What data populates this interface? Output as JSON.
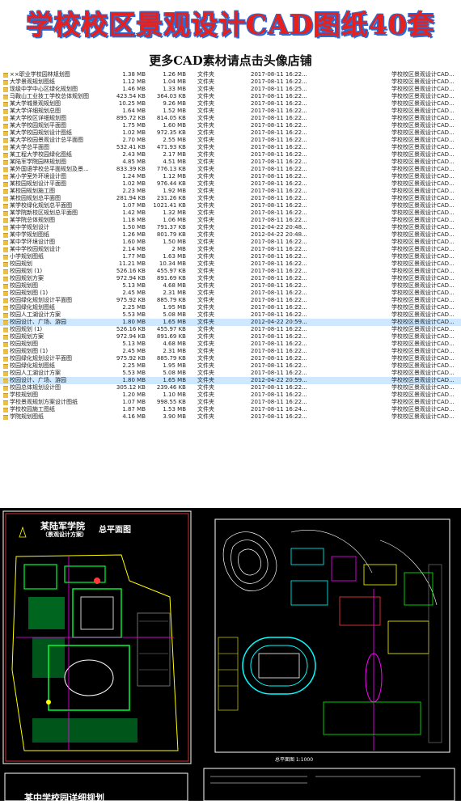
{
  "banner": {
    "title": "学校校区景观设计CAD图纸40套",
    "subtitle": "更多CAD素材请点击头像店铺"
  },
  "files": [
    {
      "name": "××职业学校园林规划图",
      "size1": "1.38 MB",
      "size2": "1.26 MB",
      "type": "文件夹",
      "date": "2017-08-11 16:22...",
      "desc": "学校校区景观设计CAD..."
    },
    {
      "name": "大学景观规划图纸",
      "size1": "1.12 MB",
      "size2": "1.04 MB",
      "type": "文件夹",
      "date": "2017-08-11 16:22...",
      "desc": "学校校区景观设计CAD..."
    },
    {
      "name": "现级中学中心区绿化规划图",
      "size1": "1.46 MB",
      "size2": "1.33 MB",
      "type": "文件夹",
      "date": "2017-08-11 16:25...",
      "desc": "学校校区景观设计CAD..."
    },
    {
      "name": "马鞍山工业技工学校总体规划图",
      "size1": "423.54 KB",
      "size2": "364.03 KB",
      "type": "文件夹",
      "date": "2017-08-11 16:22...",
      "desc": "学校校区景观设计CAD..."
    },
    {
      "name": "某大学城景观规划图",
      "size1": "10.25 MB",
      "size2": "9.26 MB",
      "type": "文件夹",
      "date": "2017-08-11 16:22...",
      "desc": "学校校区景观设计CAD..."
    },
    {
      "name": "某大学详细规划总图",
      "size1": "1.64 MB",
      "size2": "1.52 MB",
      "type": "文件夹",
      "date": "2017-08-11 16:22...",
      "desc": "学校校区景观设计CAD..."
    },
    {
      "name": "某大学校区详细规划图",
      "size1": "895.72 KB",
      "size2": "814.05 KB",
      "type": "文件夹",
      "date": "2017-08-11 16:22...",
      "desc": "学校校区景观设计CAD..."
    },
    {
      "name": "某大学校园规划平面图",
      "size1": "1.75 MB",
      "size2": "1.60 MB",
      "type": "文件夹",
      "date": "2017-08-11 16:22...",
      "desc": "学校校区景观设计CAD..."
    },
    {
      "name": "某大学校园规划设计图纸",
      "size1": "1.02 MB",
      "size2": "972.35 KB",
      "type": "文件夹",
      "date": "2017-08-11 16:22...",
      "desc": "学校校区景观设计CAD..."
    },
    {
      "name": "某大学校园景观设计总平面图",
      "size1": "2.70 MB",
      "size2": "2.55 MB",
      "type": "文件夹",
      "date": "2017-08-11 16:22...",
      "desc": "学校校区景观设计CAD..."
    },
    {
      "name": "某大学总平面图",
      "size1": "532.41 KB",
      "size2": "471.93 KB",
      "type": "文件夹",
      "date": "2017-08-11 16:22...",
      "desc": "学校校区景观设计CAD..."
    },
    {
      "name": "某工程大学校园绿化图纸",
      "size1": "2.43 MB",
      "size2": "2.17 MB",
      "type": "文件夹",
      "date": "2017-08-11 16:22...",
      "desc": "学校校区景观设计CAD..."
    },
    {
      "name": "某陆军学院园林规划图",
      "size1": "4.85 MB",
      "size2": "4.51 MB",
      "type": "文件夹",
      "date": "2017-08-11 16:22...",
      "desc": "学校校区景观设计CAD..."
    },
    {
      "name": "某外国语学校总平面规划及景...",
      "size1": "833.39 KB",
      "size2": "776.13 KB",
      "type": "文件夹",
      "date": "2017-08-11 16:22...",
      "desc": "学校校区景观设计CAD..."
    },
    {
      "name": "某小学室外环境设计图",
      "size1": "1.24 MB",
      "size2": "1.12 MB",
      "type": "文件夹",
      "date": "2017-08-11 16:22...",
      "desc": "学校校区景观设计CAD..."
    },
    {
      "name": "某校园规划设计平面图",
      "size1": "1.02 MB",
      "size2": "976.44 KB",
      "type": "文件夹",
      "date": "2017-08-11 16:22...",
      "desc": "学校校区景观设计CAD..."
    },
    {
      "name": "某校园规划施工图",
      "size1": "2.23 MB",
      "size2": "1.92 MB",
      "type": "文件夹",
      "date": "2017-08-11 16:22...",
      "desc": "学校校区景观设计CAD..."
    },
    {
      "name": "某校园规划总平面图",
      "size1": "281.94 KB",
      "size2": "231.26 KB",
      "type": "文件夹",
      "date": "2017-08-11 16:22...",
      "desc": "学校校区景观设计CAD..."
    },
    {
      "name": "某学校绿化规划总平面图",
      "size1": "1.07 MB",
      "size2": "1021.41 KB",
      "type": "文件夹",
      "date": "2017-08-11 16:22...",
      "desc": "学校校区景观设计CAD..."
    },
    {
      "name": "某学院新校区规划总平面图",
      "size1": "1.42 MB",
      "size2": "1.32 MB",
      "type": "文件夹",
      "date": "2017-08-11 16:22...",
      "desc": "学校校区景观设计CAD..."
    },
    {
      "name": "某学院总体规划图",
      "size1": "1.18 MB",
      "size2": "1.06 MB",
      "type": "文件夹",
      "date": "2017-08-11 16:22...",
      "desc": "学校校区景观设计CAD..."
    },
    {
      "name": "某中学规划设计",
      "size1": "1.50 MB",
      "size2": "791.37 KB",
      "type": "文件夹",
      "date": "2012-04-22 20:48...",
      "desc": "学校校区景观设计CAD..."
    },
    {
      "name": "某中学规划图纸",
      "size1": "1.26 MB",
      "size2": "801.79 KB",
      "type": "文件夹",
      "date": "2012-04-22 20:48...",
      "desc": "学校校区景观设计CAD..."
    },
    {
      "name": "某中学环境设计图",
      "size1": "1.60 MB",
      "size2": "1.50 MB",
      "type": "文件夹",
      "date": "2017-08-11 16:22...",
      "desc": "学校校区景观设计CAD..."
    },
    {
      "name": "某中学校园规划设计",
      "size1": "2.14 MB",
      "size2": "2 MB",
      "type": "文件夹",
      "date": "2017-08-11 16:22...",
      "desc": "学校校区景观设计CAD..."
    },
    {
      "name": "小学规划图纸",
      "size1": "1.77 MB",
      "size2": "1.63 MB",
      "type": "文件夹",
      "date": "2017-08-11 16:22...",
      "desc": "学校校区景观设计CAD..."
    },
    {
      "name": "校园规划",
      "size1": "11.21 MB",
      "size2": "10.34 MB",
      "type": "文件夹",
      "date": "2017-08-11 16:22...",
      "desc": "学校校区景观设计CAD..."
    },
    {
      "name": "校园规划 (1)",
      "size1": "526.16 KB",
      "size2": "455.97 KB",
      "type": "文件夹",
      "date": "2017-08-11 16:22...",
      "desc": "学校校区景观设计CAD..."
    },
    {
      "name": "校园规划方案",
      "size1": "972.94 KB",
      "size2": "891.69 KB",
      "type": "文件夹",
      "date": "2017-08-11 16:22...",
      "desc": "学校校区景观设计CAD..."
    },
    {
      "name": "校园规划图",
      "size1": "5.13 MB",
      "size2": "4.68 MB",
      "type": "文件夹",
      "date": "2017-08-11 16:22...",
      "desc": "学校校区景观设计CAD..."
    },
    {
      "name": "校园规划图 (1)",
      "size1": "2.45 MB",
      "size2": "2.31 MB",
      "type": "文件夹",
      "date": "2017-08-11 16:22...",
      "desc": "学校校区景观设计CAD..."
    },
    {
      "name": "校园绿化规划设计平面图",
      "size1": "975.92 KB",
      "size2": "885.79 KB",
      "type": "文件夹",
      "date": "2017-08-11 16:22...",
      "desc": "学校校区景观设计CAD..."
    },
    {
      "name": "校园绿化规划图纸",
      "size1": "2.25 MB",
      "size2": "1.95 MB",
      "type": "文件夹",
      "date": "2017-08-11 16:22...",
      "desc": "学校校区景观设计CAD..."
    },
    {
      "name": "校园人工湖设计方案",
      "size1": "5.53 MB",
      "size2": "5.08 MB",
      "type": "文件夹",
      "date": "2017-08-11 16:22...",
      "desc": "学校校区景观设计CAD..."
    },
    {
      "name": "校园设计、广场、游园",
      "size1": "1.80 MB",
      "size2": "1.65 MB",
      "type": "文件夹",
      "date": "2012-04-22 20:59...",
      "desc": "学校校区景观设计CAD...",
      "selected": true
    },
    {
      "name": "校园规划 (1)",
      "size1": "526.16 KB",
      "size2": "455.97 KB",
      "type": "文件夹",
      "date": "2017-08-11 16:22...",
      "desc": "学校校区景观设计CAD..."
    },
    {
      "name": "校园规划方案",
      "size1": "972.94 KB",
      "size2": "891.69 KB",
      "type": "文件夹",
      "date": "2017-08-11 16:22...",
      "desc": "学校校区景观设计CAD..."
    },
    {
      "name": "校园规划图",
      "size1": "5.13 MB",
      "size2": "4.68 MB",
      "type": "文件夹",
      "date": "2017-08-11 16:22...",
      "desc": "学校校区景观设计CAD..."
    },
    {
      "name": "校园规划图 (1)",
      "size1": "2.45 MB",
      "size2": "2.31 MB",
      "type": "文件夹",
      "date": "2017-08-11 16:22...",
      "desc": "学校校区景观设计CAD..."
    },
    {
      "name": "校园绿化规划设计平面图",
      "size1": "975.92 KB",
      "size2": "885.79 KB",
      "type": "文件夹",
      "date": "2017-08-11 16:22...",
      "desc": "学校校区景观设计CAD..."
    },
    {
      "name": "校园绿化规划图纸",
      "size1": "2.25 MB",
      "size2": "1.95 MB",
      "type": "文件夹",
      "date": "2017-08-11 16:22...",
      "desc": "学校校区景观设计CAD..."
    },
    {
      "name": "校园人工湖设计方案",
      "size1": "5.53 MB",
      "size2": "5.08 MB",
      "type": "文件夹",
      "date": "2017-08-11 16:22...",
      "desc": "学校校区景观设计CAD..."
    },
    {
      "name": "校园设计、广场、游园",
      "size1": "1.80 MB",
      "size2": "1.65 MB",
      "type": "文件夹",
      "date": "2012-04-22 20:59...",
      "desc": "学校校区景观设计CAD...",
      "selected": true
    },
    {
      "name": "校园总体规划设计图",
      "size1": "305.12 KB",
      "size2": "239.46 KB",
      "type": "文件夹",
      "date": "2017-08-11 16:22...",
      "desc": "学校校区景观设计CAD..."
    },
    {
      "name": "学校规划图",
      "size1": "1.20 MB",
      "size2": "1.10 MB",
      "type": "文件夹",
      "date": "2017-08-11 16:22...",
      "desc": "学校校区景观设计CAD..."
    },
    {
      "name": "学校景观规划方案设计图纸",
      "size1": "1.07 MB",
      "size2": "998.55 KB",
      "type": "文件夹",
      "date": "2017-08-11 16:22...",
      "desc": "学校校区景观设计CAD..."
    },
    {
      "name": "学校校园施工图纸",
      "size1": "1.87 MB",
      "size2": "1.53 MB",
      "type": "文件夹",
      "date": "2017-08-11 16:24...",
      "desc": "学校校区景观设计CAD..."
    },
    {
      "name": "学院规划图纸",
      "size1": "4.16 MB",
      "size2": "3.90 MB",
      "type": "文件夹",
      "date": "2017-08-11 16:22...",
      "desc": "学校校区景观设计CAD..."
    }
  ],
  "cad_left": {
    "title": "某陆军学院",
    "subtitle": "（景观设计方案）",
    "heading": "总平面图"
  },
  "cad_right": {
    "scale_label": "总平面图 1:1000"
  },
  "cad_bottom": {
    "label": "某中学校园详细规划"
  }
}
